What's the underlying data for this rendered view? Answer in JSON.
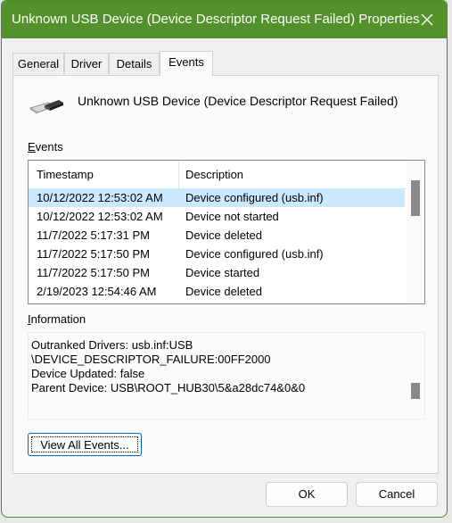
{
  "window": {
    "title": "Unknown USB Device (Device Descriptor Request Failed) Properties"
  },
  "tabs": [
    {
      "label": "General"
    },
    {
      "label": "Driver"
    },
    {
      "label": "Details"
    },
    {
      "label": "Events"
    }
  ],
  "active_tab": "Events",
  "device": {
    "name": "Unknown USB Device (Device Descriptor Request Failed)",
    "icon": "usb-icon"
  },
  "events": {
    "label": "Events",
    "columns": [
      "Timestamp",
      "Description"
    ],
    "rows": [
      {
        "timestamp": "10/12/2022 12:53:02 AM",
        "description": "Device configured (usb.inf)",
        "selected": true
      },
      {
        "timestamp": "10/12/2022 12:53:02 AM",
        "description": "Device not started"
      },
      {
        "timestamp": "11/7/2022 5:17:31 PM",
        "description": "Device deleted"
      },
      {
        "timestamp": "11/7/2022 5:17:50 PM",
        "description": "Device configured (usb.inf)"
      },
      {
        "timestamp": "11/7/2022 5:17:50 PM",
        "description": "Device started"
      },
      {
        "timestamp": "2/19/2023 12:54:46 AM",
        "description": "Device deleted"
      }
    ]
  },
  "information": {
    "label": "Information",
    "lines": [
      "Outranked Drivers: usb.inf:USB",
      "\\DEVICE_DESCRIPTOR_FAILURE:00FF2000",
      "Device Updated: false",
      "Parent Device: USB\\ROOT_HUB30\\5&a28dc74&0&0"
    ]
  },
  "buttons": {
    "view_all": "View All Events...",
    "ok": "OK",
    "cancel": "Cancel"
  },
  "colors": {
    "titlebar": "#53922a",
    "selection": "#cce8ff",
    "focus": "#0067c0"
  }
}
